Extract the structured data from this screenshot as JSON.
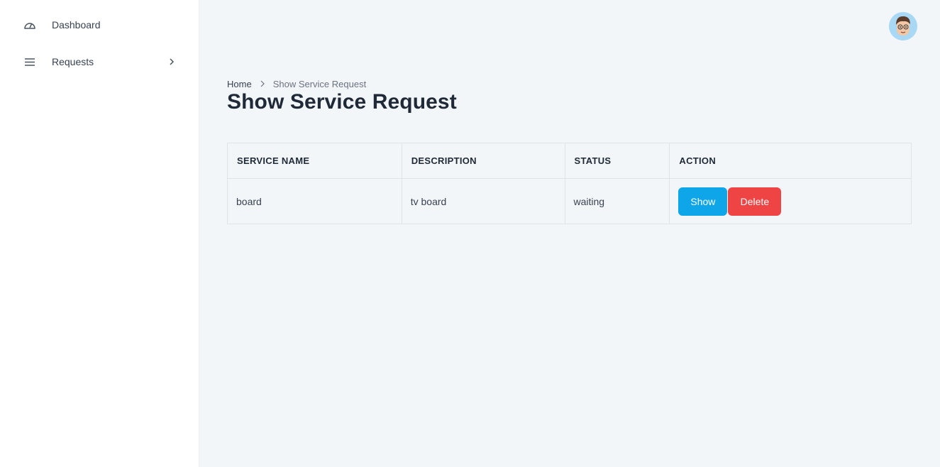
{
  "sidebar": {
    "items": [
      {
        "label": "Dashboard",
        "icon": "gauge-icon"
      },
      {
        "label": "Requests",
        "icon": "menu-icon"
      }
    ]
  },
  "header": {
    "avatar_icon": "avatar"
  },
  "breadcrumb": {
    "home": "Home",
    "current": "Show Service Request"
  },
  "page": {
    "title": "Show Service Request"
  },
  "table": {
    "headers": [
      "SERVICE NAME",
      "DESCRIPTION",
      "STATUS",
      "ACTION"
    ],
    "rows": [
      {
        "service_name": "board",
        "description": "tv board",
        "status": "waiting",
        "show_label": "Show",
        "delete_label": "Delete"
      }
    ]
  },
  "colors": {
    "show_button": "#0ea5e9",
    "delete_button": "#ef4444",
    "background": "#f3f6f9",
    "sidebar": "#ffffff"
  }
}
